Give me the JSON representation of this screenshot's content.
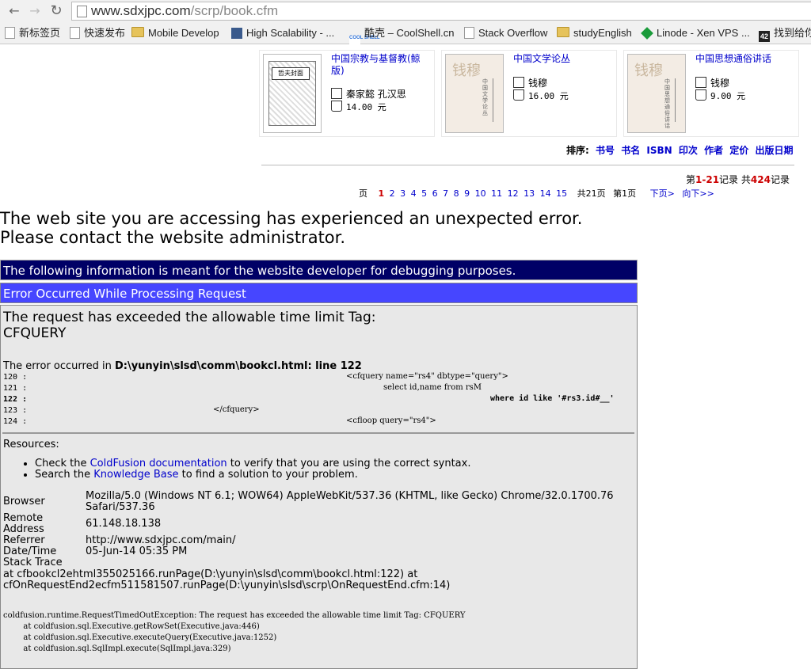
{
  "browser": {
    "url_host": "www.sdxjpc.com",
    "url_path": "/scrp/book.cfm",
    "bookmarks": [
      {
        "label": "新标签页",
        "icon": "page-icon"
      },
      {
        "label": "快速发布",
        "icon": "page-icon"
      },
      {
        "label": "Mobile Develop",
        "icon": "folder-icon"
      },
      {
        "label": "High Scalability - ...",
        "icon": "high-scalability-icon"
      },
      {
        "label": "酷壳 – CoolShell.cn",
        "icon": "coolshell-icon"
      },
      {
        "label": "Stack Overflow",
        "icon": "page-icon"
      },
      {
        "label": "studyEnglish",
        "icon": "folder-icon"
      },
      {
        "label": "Linode - Xen VPS ...",
        "icon": "linode-icon"
      },
      {
        "label": "找到给你",
        "icon": "42-icon"
      }
    ],
    "cool_badge": "COOL SHELL",
    "n42_badge": "42"
  },
  "books": [
    {
      "title": "中国宗教与基督教(鲸版)",
      "author": "秦家懿 孔汉思",
      "price": "14.00 元",
      "cover_tag": "哲夫封面"
    },
    {
      "title": "中国文学论丛",
      "author": "钱穆",
      "price": "16.00 元",
      "cover_tag": "中国文学论丛"
    },
    {
      "title": "中国思想通俗讲话",
      "author": "钱穆",
      "price": "9.00 元",
      "cover_tag": "中国思想通俗讲话"
    }
  ],
  "sort": {
    "label": "排序:",
    "options": [
      "书号",
      "书名",
      "ISBN",
      "印次",
      "作者",
      "定价",
      "出版日期"
    ]
  },
  "records": {
    "prefix": "第",
    "range": "1-21",
    "mid": "记录  共",
    "total": "424",
    "suffix": "记录"
  },
  "pager": {
    "label": "页",
    "current": "1",
    "pages": [
      "2",
      "3",
      "4",
      "5",
      "6",
      "7",
      "8",
      "9",
      "10",
      "11",
      "12",
      "13",
      "14",
      "15"
    ],
    "total_text": "共21页",
    "page_pos": "第1页",
    "next": "下页>",
    "next_group": "向下>>"
  },
  "error": {
    "heading_line1": "The web site you are accessing has experienced an unexpected error.",
    "heading_line2": "Please contact the website administrator.",
    "dev_notice": "The following information is meant for the website developer for debugging purposes.",
    "proc_title": "Error Occurred While Processing Request",
    "message_line1": "The request has exceeded the allowable time limit Tag:",
    "message_line2": "CFQUERY",
    "location_prefix": "The error occurred in ",
    "location": "D:\\yunyin\\slsd\\comm\\bookcl.html: line 122",
    "code": [
      {
        "num": "120 :",
        "text": "<cfquery name=\"rs4\" dbtype=\"query\">"
      },
      {
        "num": "121 :",
        "text": "select id,name from rsM"
      },
      {
        "num": "122 :",
        "text": "where id like '#rs3.id#__'"
      },
      {
        "num": "123 :",
        "text": "</cfquery>"
      },
      {
        "num": "124 :",
        "text": "<cfloop query=\"rs4\">"
      }
    ],
    "resources_title": "Resources:",
    "res1_pre": "Check the ",
    "res1_link": "ColdFusion documentation",
    "res1_post": " to verify that you are using the correct syntax.",
    "res2_pre": "Search the ",
    "res2_link": "Knowledge Base",
    "res2_post": " to find a solution to your problem.",
    "browser_label": "Browser",
    "browser_value": "Mozilla/5.0 (Windows NT 6.1; WOW64) AppleWebKit/537.36 (KHTML, like Gecko) Chrome/32.0.1700.76 Safari/537.36",
    "remote_label": "Remote Address",
    "remote_value": "61.148.18.138",
    "referrer_label": "Referrer",
    "referrer_value": "http://www.sdxjpc.com/main/",
    "datetime_label": "Date/Time",
    "datetime_value": "05-Jun-14 05:35 PM",
    "stack_label": "Stack Trace",
    "stack1": "at cfbookcl2ehtml355025166.runPage(D:\\yunyin\\slsd\\comm\\bookcl.html:122) at",
    "stack2": "cfOnRequestEnd2ecfm511581507.runPage(D:\\yunyin\\slsd\\scrp\\OnRequestEnd.cfm:14)",
    "java": [
      "coldfusion.runtime.RequestTimedOutException: The request has exceeded the allowable time limit Tag: CFQUERY",
      "        at coldfusion.sql.Executive.getRowSet(Executive.java:446)",
      "        at coldfusion.sql.Executive.executeQuery(Executive.java:1252)",
      "        at coldfusion.sql.SqlImpl.execute(SqlImpl.java:329)"
    ]
  }
}
